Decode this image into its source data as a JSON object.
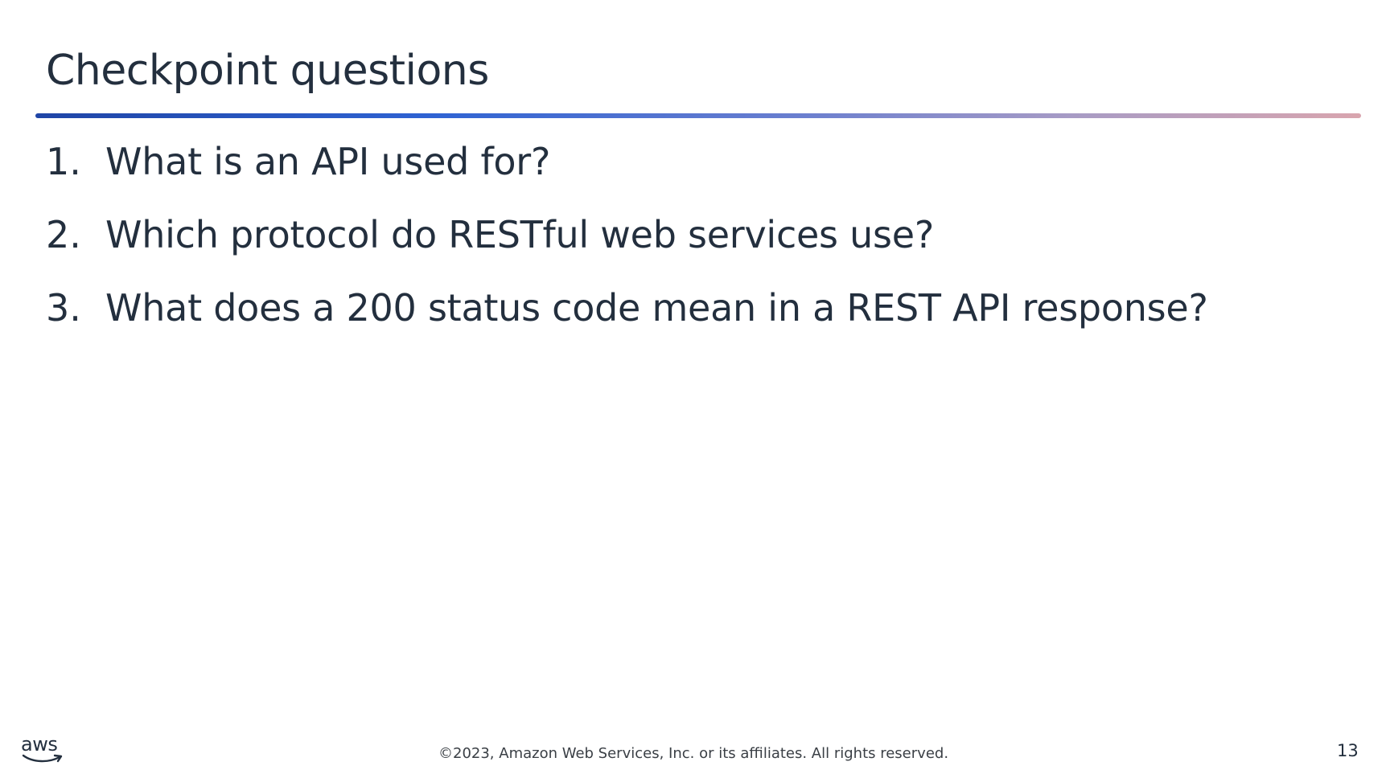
{
  "slide": {
    "title": "Checkpoint questions",
    "questions": [
      {
        "number": "1.",
        "text": "What is an API used for?"
      },
      {
        "number": "2.",
        "text": "Which protocol do RESTful web services use?"
      },
      {
        "number": "3.",
        "text": "What does a 200 status code mean in a REST API response?"
      }
    ]
  },
  "footer": {
    "logo_text": "aws",
    "copyright": "©2023, Amazon Web Services, Inc. or its affiliates. All rights reserved.",
    "page_number": "13"
  },
  "colors": {
    "text": "#232f3e",
    "rule_start": "#1f45a6",
    "rule_end": "#d9a5ae"
  },
  "icons": {
    "logo": "aws-logo-icon"
  }
}
